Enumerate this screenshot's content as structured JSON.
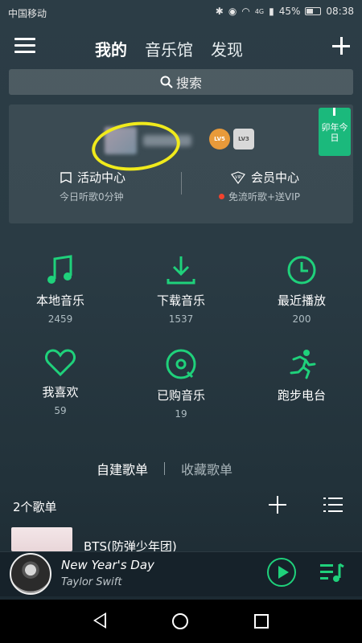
{
  "status_bar": {
    "carrier": "中国移动",
    "network": "4G",
    "battery": "45%",
    "time": "08:38"
  },
  "header": {
    "tabs": [
      {
        "label": "我的",
        "active": true
      },
      {
        "label": "音乐馆",
        "active": false
      },
      {
        "label": "发现",
        "active": false
      }
    ]
  },
  "search": {
    "label": "搜索"
  },
  "profile": {
    "badge_lv5": "LV5",
    "badge_lv3": "LV3",
    "calendar_label": "卯年今日",
    "activity_label": "活动中心",
    "activity_sub": "今日听歌0分钟",
    "vip_label": "会员中心",
    "vip_sub": "免流听歌+送VIP"
  },
  "grid": [
    {
      "label": "本地音乐",
      "count": "2459",
      "icon": "music-note-icon"
    },
    {
      "label": "下载音乐",
      "count": "1537",
      "icon": "download-icon"
    },
    {
      "label": "最近播放",
      "count": "200",
      "icon": "clock-icon"
    },
    {
      "label": "我喜欢",
      "count": "59",
      "icon": "heart-icon"
    },
    {
      "label": "已购音乐",
      "count": "19",
      "icon": "purchased-disc-icon"
    },
    {
      "label": "跑步电台",
      "count": "",
      "icon": "running-icon"
    }
  ],
  "playlists": {
    "tab_created": "自建歌单",
    "tab_collected": "收藏歌单",
    "count_label": "2个歌单",
    "first_title": "BTS(防弹少年团)"
  },
  "player": {
    "song": "New Year's Day",
    "artist": "Taylor Swift"
  },
  "colors": {
    "accent": "#1fd17b",
    "highlight": "#f0ea1c",
    "vip_dot": "#f2422d"
  }
}
